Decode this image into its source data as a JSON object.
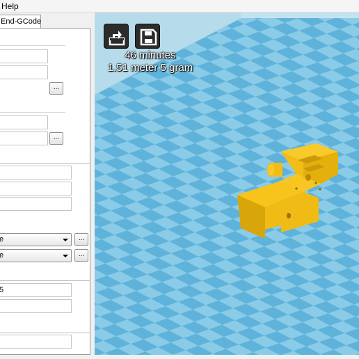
{
  "menu": {
    "help_label": "Help"
  },
  "tabs": {
    "end_gcode_label": "End-GCode"
  },
  "fields": {
    "f7": "5"
  },
  "selects": {
    "s1": "e",
    "s2": "e"
  },
  "buttons": {
    "browse_label": "..."
  },
  "viewport": {
    "print_time": "46 minutes",
    "print_cost": "1.51 meter 5 gram",
    "load_icon": "load-model-icon",
    "save_icon": "save-gcode-icon",
    "model_color": "#f5c013",
    "floor_color_a": "#5fb3da",
    "floor_color_b": "#8acbe7",
    "wall_color": "#b6dcec"
  }
}
